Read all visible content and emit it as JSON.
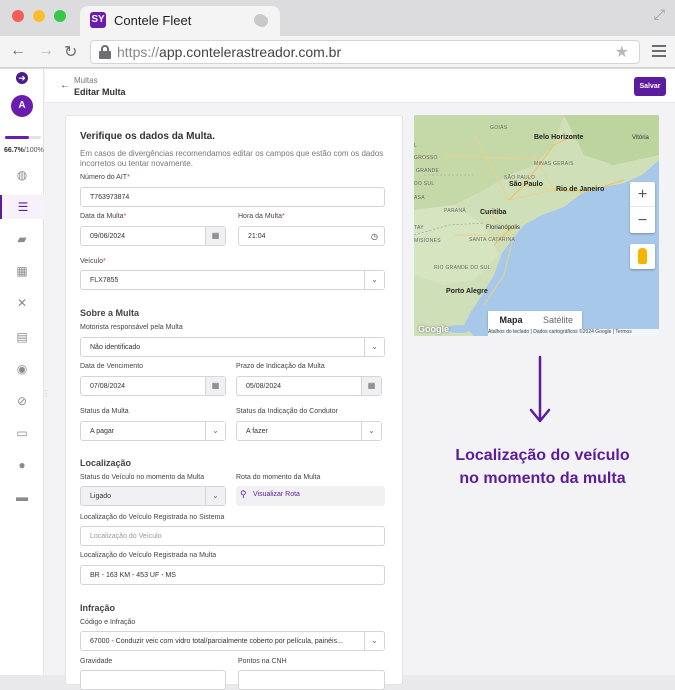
{
  "browser": {
    "tab_title": "Contele Fleet",
    "tab_logo": "SY",
    "url_protocol": "https://",
    "url_host": "app.contelerastreador.com.br"
  },
  "sidebar": {
    "avatar_initial": "A",
    "progress_percent": 66.7,
    "progress_value": "66.7%",
    "progress_total": "/100%",
    "icons": [
      "globe-icon",
      "list-icon",
      "car-icon",
      "grid-icon",
      "tools-icon",
      "receipt-icon",
      "target-icon",
      "block-icon",
      "id-card-icon",
      "user-icon",
      "car-front-icon"
    ],
    "active_icon": "list-icon"
  },
  "header": {
    "breadcrumb_parent": "Multas",
    "title": "Editar Multa",
    "save_label": "Salvar"
  },
  "form": {
    "heading": "Verifique os dados da Multa.",
    "description": "Em casos de divergências recomendamos editar os campos que estão com os dados incorretos ou tentar novamente.",
    "ait_label": "Número do AIT",
    "ait_value": "T763973874",
    "data_multa_label": "Data da Multa",
    "data_multa_value": "09/06/2024",
    "hora_multa_label": "Hora da Multa",
    "hora_multa_value": "21:04",
    "veiculo_label": "Veículo",
    "veiculo_value": "FLX7855",
    "sobre_section": "Sobre a Multa",
    "motorista_label": "Motorista responsável pela Multa",
    "motorista_value": "Não identificado",
    "vencimento_label": "Data de Vencimento",
    "vencimento_value": "07/08/2024",
    "prazo_label": "Prazo de Indicação da Multa",
    "prazo_value": "05/08/2024",
    "status_label": "Status da Multa",
    "status_value": "A pagar",
    "status_indicacao_label": "Status da Indicação do Condutor",
    "status_indicacao_value": "A fazer",
    "localizacao_section": "Localização",
    "status_veiculo_label": "Status do Veículo no momento da Multa",
    "status_veiculo_value": "Ligado",
    "rota_label": "Rota do momento da Multa",
    "rota_link": "Visualizar Rota",
    "loc_sistema_label": "Localização do Veículo Registrada no Sistema",
    "loc_sistema_placeholder": "Localização do Veículo",
    "loc_multa_label": "Localização do Veículo Registrada na Multa",
    "loc_multa_value": "BR - 163 KM - 453 UF - MS",
    "infracao_section": "Infração",
    "codigo_label": "Código e Infração",
    "codigo_value": "67000 - Conduzir veic com vidro total/parcialmente coberto por película, painéis...",
    "gravidade_label": "Gravidade",
    "pontos_label": "Pontos na CNH"
  },
  "map": {
    "cities": [
      "Belo Horizonte",
      "São Paulo",
      "Rio de Janeiro",
      "Curitiba",
      "Porto Alegre",
      "Florianópolis",
      "Vitória"
    ],
    "states": [
      "GOIÁS",
      "MINAS GERAIS",
      "SÃO PAULO",
      "PARANÁ",
      "SANTA CATARINA",
      "RIO GRANDE DO SUL",
      "MISIONES"
    ],
    "partial_labels": [
      "GROSSO",
      "GRANDE",
      "L",
      "DO SUL",
      "ASA",
      "TAY"
    ],
    "maptype_map": "Mapa",
    "maptype_satellite": "Satélite",
    "attribution": "Atalhos do teclado  |  Dados cartográficos ©2024 Google  |  Termos",
    "google": "Google"
  },
  "caption": {
    "line1": "Localização do veículo",
    "line2": "no momento da multa"
  },
  "colors": {
    "brand": "#5b1c9e",
    "required": "#dd3333"
  }
}
